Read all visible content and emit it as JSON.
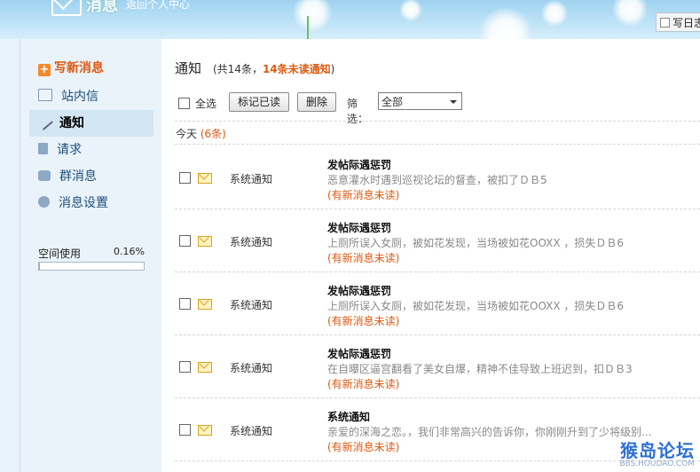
{
  "header": {
    "title": "消息",
    "subtitle": "返回个人中心",
    "write_diary": "写日志"
  },
  "sidebar": {
    "compose": "写新消息",
    "items": [
      {
        "label": "站内信",
        "icon": "mail-icon"
      },
      {
        "label": "通知",
        "icon": "pencil-icon",
        "active": true
      },
      {
        "label": "请求",
        "icon": "document-icon"
      },
      {
        "label": "群消息",
        "icon": "speech-bubble-icon"
      },
      {
        "label": "消息设置",
        "icon": "settings-icon"
      }
    ],
    "usage_label": "空间使用",
    "usage_percent": "0.16%",
    "usage_fraction": 0.0016
  },
  "main": {
    "title": "通知",
    "count_prefix": "(共14条，",
    "count_unread": "14条未读通知",
    "count_suffix": ")",
    "toolbar": {
      "select_all": "全选",
      "mark_read": "标记已读",
      "delete": "删除",
      "filter_label": "筛选：",
      "filter_value": "全部"
    },
    "group": {
      "label": "今天",
      "count": "(6条)"
    },
    "notifications": [
      {
        "type": "系统通知",
        "title": "发帖际遇惩罚",
        "body": "恶意灌水时遇到巡视论坛的督查，被扣了ＤＢ5",
        "status": "(有新消息未读)"
      },
      {
        "type": "系统通知",
        "title": "发帖际遇惩罚",
        "body": "上厕所误入女厕，被如花发现，当场被如花OOXX ，损失ＤＢ6",
        "status": "(有新消息未读)"
      },
      {
        "type": "系统通知",
        "title": "发帖际遇惩罚",
        "body": "上厕所误入女厕，被如花发现，当场被如花OOXX ，损失ＤＢ6",
        "status": "(有新消息未读)"
      },
      {
        "type": "系统通知",
        "title": "发帖际遇惩罚",
        "body": "在自曝区逼宫翻看了美女自爆，精神不佳导致上班迟到，扣ＤＢ3",
        "status": "(有新消息未读)"
      },
      {
        "type": "系统通知",
        "title": "系统通知",
        "body": "亲爱的深海之恋。，我们非常高兴的告诉你，你刚刚升到了少将级别...",
        "status": "(有新消息未读)"
      }
    ]
  },
  "watermark": {
    "line1": "猴岛论坛",
    "line2": "BBS.HOUDAO.COM"
  }
}
